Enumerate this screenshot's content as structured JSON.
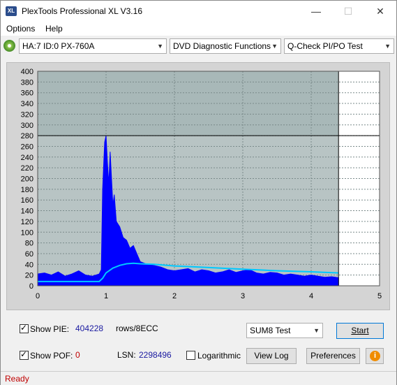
{
  "window": {
    "title": "PlexTools Professional XL V3.16",
    "icon_text": "XL",
    "min_glyph": "—",
    "max_glyph": "☐",
    "close_glyph": "✕"
  },
  "menu": {
    "options": "Options",
    "help": "Help"
  },
  "toolbar": {
    "drive": "HA:7 ID:0  PX-760A",
    "function": "DVD Diagnostic Functions",
    "test": "Q-Check PI/PO Test"
  },
  "chart_data": {
    "type": "area",
    "ylim": [
      0,
      400
    ],
    "xlim": [
      0,
      5
    ],
    "y_ticks": [
      0,
      20,
      40,
      60,
      80,
      100,
      120,
      140,
      160,
      180,
      200,
      220,
      240,
      260,
      280,
      300,
      320,
      340,
      360,
      380,
      400
    ],
    "x_ticks": [
      0,
      1,
      2,
      3,
      4,
      5
    ],
    "threshold_y": 280,
    "end_marker_x": 4.4,
    "grid": true,
    "series": [
      {
        "color": "#0000ff",
        "x": [
          0,
          0.1,
          0.2,
          0.3,
          0.4,
          0.5,
          0.6,
          0.7,
          0.8,
          0.9,
          0.93,
          0.95,
          0.97,
          0.98,
          1.0,
          1.02,
          1.04,
          1.06,
          1.08,
          1.1,
          1.12,
          1.15,
          1.2,
          1.25,
          1.3,
          1.35,
          1.4,
          1.45,
          1.5,
          1.6,
          1.7,
          1.8,
          1.9,
          2.0,
          2.1,
          2.2,
          2.3,
          2.4,
          2.5,
          2.6,
          2.7,
          2.8,
          2.9,
          3.0,
          3.1,
          3.2,
          3.3,
          3.4,
          3.5,
          3.6,
          3.7,
          3.8,
          3.9,
          4.0,
          4.1,
          4.2,
          4.3,
          4.4
        ],
        "y": [
          22,
          24,
          20,
          26,
          18,
          22,
          28,
          20,
          18,
          22,
          30,
          180,
          240,
          268,
          280,
          230,
          190,
          250,
          200,
          150,
          170,
          120,
          110,
          90,
          85,
          70,
          75,
          60,
          45,
          40,
          38,
          35,
          30,
          28,
          30,
          32,
          26,
          30,
          28,
          24,
          26,
          30,
          25,
          28,
          30,
          24,
          22,
          25,
          24,
          20,
          22,
          20,
          18,
          20,
          18,
          16,
          17,
          15
        ]
      },
      {
        "color": "#00c8ff",
        "x": [
          0,
          0.5,
          0.9,
          0.95,
          1.0,
          1.1,
          1.2,
          1.3,
          1.4,
          1.5,
          1.7,
          2.0,
          2.5,
          3.0,
          3.5,
          4.0,
          4.4
        ],
        "y": [
          8,
          8,
          8,
          14,
          24,
          33,
          38,
          41,
          42,
          41,
          40,
          37,
          34,
          31,
          28,
          26,
          24
        ]
      }
    ]
  },
  "controls": {
    "show_pie_label": "Show PIE:",
    "pie_value": "404228",
    "rows_label": "rows/8ECC",
    "test_select": "SUM8 Test",
    "start_label": "Start",
    "show_pof_label": "Show POF:",
    "pof_value": "0",
    "lsn_label": "LSN:",
    "lsn_value": "2298496",
    "log_label": "Logarithmic",
    "view_log_label": "View Log",
    "preferences_label": "Preferences",
    "info_glyph": "i"
  },
  "status": {
    "text": "Ready"
  }
}
